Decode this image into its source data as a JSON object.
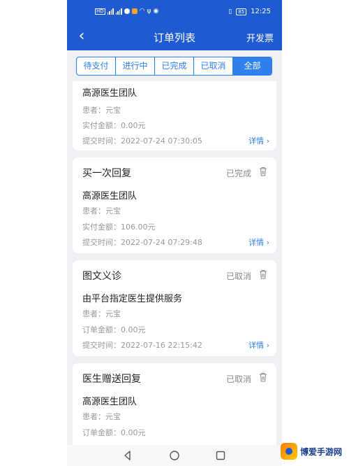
{
  "status_bar": {
    "left_icons": [
      "sim-icon",
      "signal-icon",
      "signal-icon",
      "chat-icon",
      "app-icon",
      "wifi-icon",
      "usb-icon",
      "record-icon"
    ],
    "battery": "85",
    "time": "12:25"
  },
  "navbar": {
    "back_symbol": "‹",
    "title": "订单列表",
    "action": "开发票"
  },
  "tabs": [
    {
      "label": "待支付",
      "active": false
    },
    {
      "label": "进行中",
      "active": false
    },
    {
      "label": "已完成",
      "active": false
    },
    {
      "label": "已取消",
      "active": false
    },
    {
      "label": "全部",
      "active": true
    }
  ],
  "orders": [
    {
      "type": "",
      "status": "",
      "team": "高源医生团队",
      "patient_label": "患者：",
      "patient": "元宝",
      "amount_label": "实付金额：",
      "amount": "0.00元",
      "time_label": "提交时间：",
      "time": "2022-07-24 07:30:05",
      "detail": "详情 ›"
    },
    {
      "type": "买一次回复",
      "status": "已完成",
      "team": "高源医生团队",
      "patient_label": "患者：",
      "patient": "元宝",
      "amount_label": "实付金额：",
      "amount": "106.00元",
      "time_label": "提交时间：",
      "time": "2022-07-24 07:29:48",
      "detail": "详情 ›"
    },
    {
      "type": "图文义诊",
      "status": "已取消",
      "team": "由平台指定医生提供服务",
      "patient_label": "患者：",
      "patient": "元宝",
      "amount_label": "订单金额：",
      "amount": "0.00元",
      "time_label": "提交时间：",
      "time": "2022-07-16 22:15:42",
      "detail": "详情 ›"
    },
    {
      "type": "医生赠送回复",
      "status": "已取消",
      "team": "高源医生团队",
      "patient_label": "患者：",
      "patient": "元宝",
      "amount_label": "订单金额：",
      "amount": "0.00元",
      "time_label": "",
      "time": "",
      "detail": ""
    }
  ],
  "watermark": {
    "text": "博爱手游网"
  },
  "colors": {
    "primary": "#1f5bd0",
    "accent": "#2f80ed",
    "background": "#f0f1f5"
  }
}
